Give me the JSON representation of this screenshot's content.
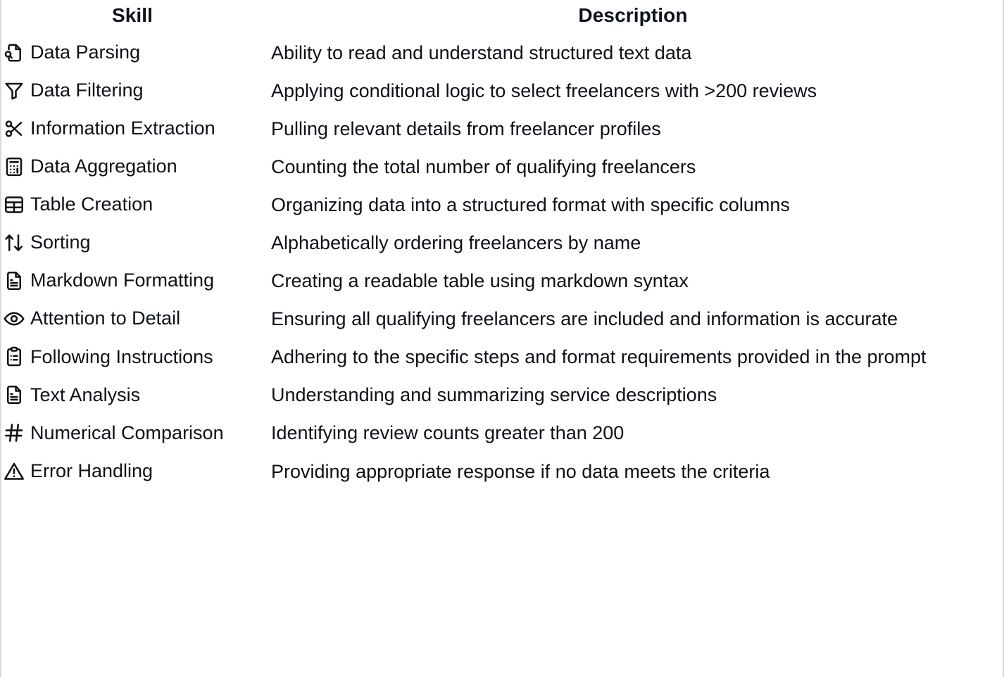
{
  "table": {
    "columns": [
      {
        "key": "skill",
        "label": "Skill"
      },
      {
        "key": "description",
        "label": "Description"
      }
    ],
    "rows": [
      {
        "icon": "file-search-icon",
        "skill": "Data Parsing",
        "description": "Ability to read and understand structured text data"
      },
      {
        "icon": "funnel-filter-icon",
        "skill": "Data Filtering",
        "description": "Applying conditional logic to select freelancers with >200 reviews"
      },
      {
        "icon": "scissors-icon",
        "skill": "Information Extraction",
        "description": "Pulling relevant details from freelancer profiles"
      },
      {
        "icon": "calculator-icon",
        "skill": "Data Aggregation",
        "description": "Counting the total number of qualifying freelancers"
      },
      {
        "icon": "table-grid-icon",
        "skill": "Table Creation",
        "description": "Organizing data into a structured format with specific columns"
      },
      {
        "icon": "sort-arrows-icon",
        "skill": "Sorting",
        "description": "Alphabetically ordering freelancers by name"
      },
      {
        "icon": "document-lines-icon",
        "skill": "Markdown Formatting",
        "description": "Creating a readable table using markdown syntax"
      },
      {
        "icon": "eye-icon",
        "skill": "Attention to Detail",
        "description": "Ensuring all qualifying freelancers are included and information is accurate"
      },
      {
        "icon": "clipboard-list-icon",
        "skill": "Following Instructions",
        "description": "Adhering to the specific steps and format requirements provided in the prompt"
      },
      {
        "icon": "document-lines-icon",
        "skill": "Text Analysis",
        "description": "Understanding and summarizing service descriptions"
      },
      {
        "icon": "hash-icon",
        "skill": "Numerical Comparison",
        "description": "Identifying review counts greater than 200"
      },
      {
        "icon": "warning-triangle-icon",
        "skill": "Error Handling",
        "description": "Providing appropriate response if no data meets the criteria"
      }
    ]
  },
  "clipped_top_row": {
    "left_fragment": "",
    "right_fragment": ""
  },
  "colors": {
    "text": "#0d1117",
    "background": "#ffffff",
    "border": "#d9d9d4"
  }
}
